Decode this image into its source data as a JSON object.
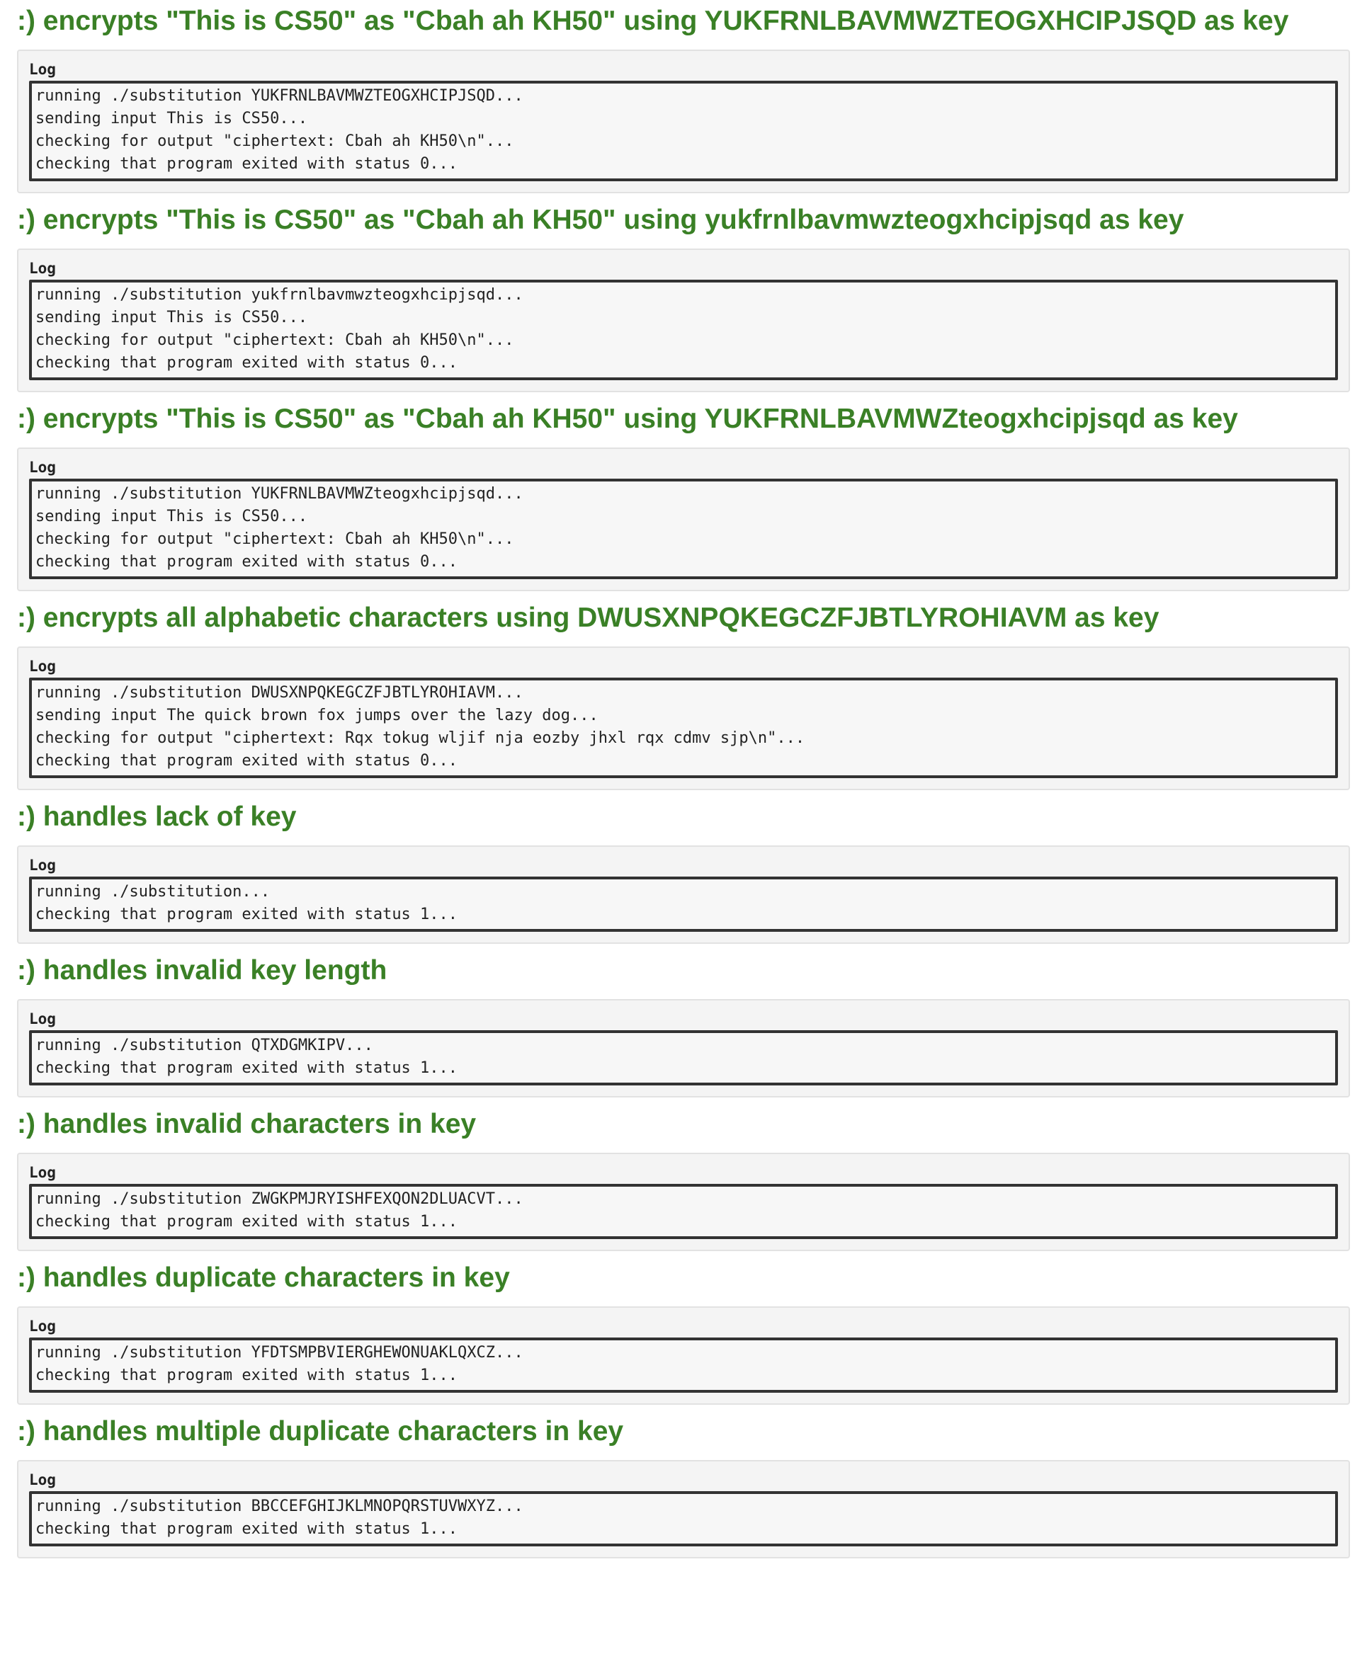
{
  "checks": [
    {
      "title": ":) encrypts \"This is CS50\" as \"Cbah ah KH50\" using YUKFRNLBAVMWZTEOGXHCIPJSQD as key",
      "log_label": "Log",
      "log": [
        "running ./substitution YUKFRNLBAVMWZTEOGXHCIPJSQD...",
        "sending input This is CS50...",
        "checking for output \"ciphertext: Cbah ah KH50\\n\"...",
        "checking that program exited with status 0..."
      ]
    },
    {
      "title": ":) encrypts \"This is CS50\" as \"Cbah ah KH50\" using yukfrnlbavmwzteogxhcipjsqd as key",
      "log_label": "Log",
      "log": [
        "running ./substitution yukfrnlbavmwzteogxhcipjsqd...",
        "sending input This is CS50...",
        "checking for output \"ciphertext: Cbah ah KH50\\n\"...",
        "checking that program exited with status 0..."
      ]
    },
    {
      "title": ":) encrypts \"This is CS50\" as \"Cbah ah KH50\" using YUKFRNLBAVMWZteogxhcipjsqd as key",
      "log_label": "Log",
      "log": [
        "running ./substitution YUKFRNLBAVMWZteogxhcipjsqd...",
        "sending input This is CS50...",
        "checking for output \"ciphertext: Cbah ah KH50\\n\"...",
        "checking that program exited with status 0..."
      ]
    },
    {
      "title": ":) encrypts all alphabetic characters using DWUSXNPQKEGCZFJBTLYROHIAVM as key",
      "log_label": "Log",
      "log": [
        "running ./substitution DWUSXNPQKEGCZFJBTLYROHIAVM...",
        "sending input The quick brown fox jumps over the lazy dog...",
        "checking for output \"ciphertext: Rqx tokug wljif nja eozby jhxl rqx cdmv sjp\\n\"...",
        "checking that program exited with status 0..."
      ]
    },
    {
      "title": ":) handles lack of key",
      "log_label": "Log",
      "log": [
        "running ./substitution...",
        "checking that program exited with status 1..."
      ]
    },
    {
      "title": ":) handles invalid key length",
      "log_label": "Log",
      "log": [
        "running ./substitution QTXDGMKIPV...",
        "checking that program exited with status 1..."
      ]
    },
    {
      "title": ":) handles invalid characters in key",
      "log_label": "Log",
      "log": [
        "running ./substitution ZWGKPMJRYISHFEXQON2DLUACVT...",
        "checking that program exited with status 1..."
      ]
    },
    {
      "title": ":) handles duplicate characters in key",
      "log_label": "Log",
      "log": [
        "running ./substitution YFDTSMPBVIERGHEWONUAKLQXCZ...",
        "checking that program exited with status 1..."
      ]
    },
    {
      "title": ":) handles multiple duplicate characters in key",
      "log_label": "Log",
      "log": [
        "running ./substitution BBCCEFGHIJKLMNOPQRSTUVWXYZ...",
        "checking that program exited with status 1..."
      ]
    }
  ],
  "colors": {
    "pass_title": "#3a8026",
    "card_background": "#f4f4f4",
    "card_border": "#e2e2e2",
    "log_border": "#333333",
    "text": "#222222"
  }
}
